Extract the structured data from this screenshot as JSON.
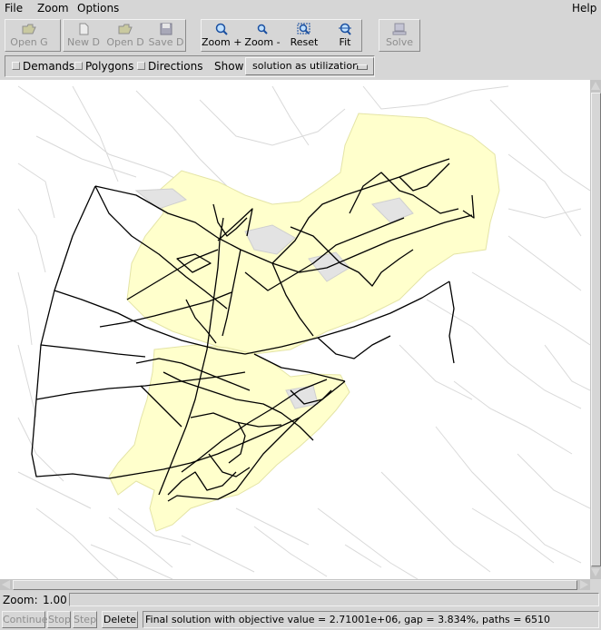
{
  "menu": {
    "file": "File",
    "zoom": "Zoom",
    "options": "Options",
    "help": "Help"
  },
  "toolbar": {
    "open_g": "Open G",
    "new_d": "New D",
    "open_d": "Open D",
    "save_d": "Save D",
    "zoom_in": "Zoom +",
    "zoom_out": "Zoom -",
    "reset": "Reset",
    "fit": "Fit",
    "solve": "Solve"
  },
  "options": {
    "demands": "Demands",
    "polygons": "Polygons",
    "directions": "Directions",
    "show_label": "Show",
    "show_value": "solution as utilization"
  },
  "zoom": {
    "label": "Zoom:",
    "value": "1.00"
  },
  "status": {
    "continue": "Continue",
    "stop": "Stop",
    "step": "Step",
    "delete": "Delete",
    "message": "Final solution with objective value = 2.71001e+06, gap = 3.834%, paths = 6510"
  },
  "colors": {
    "ui_bg": "#d6d6d6",
    "map_region": "#ffffcc",
    "map_background": "#ffffff",
    "road_light": "#d9d9d9",
    "route_dark": "#000000"
  },
  "icons": {
    "open_g": "folder-open-icon",
    "new_d": "new-document-icon",
    "open_d": "folder-open-icon",
    "save_d": "floppy-disk-icon",
    "zoom_in": "magnifier-plus-icon",
    "zoom_out": "magnifier-minus-icon",
    "reset": "magnifier-reset-icon",
    "fit": "magnifier-fit-icon",
    "solve": "solve-icon"
  }
}
